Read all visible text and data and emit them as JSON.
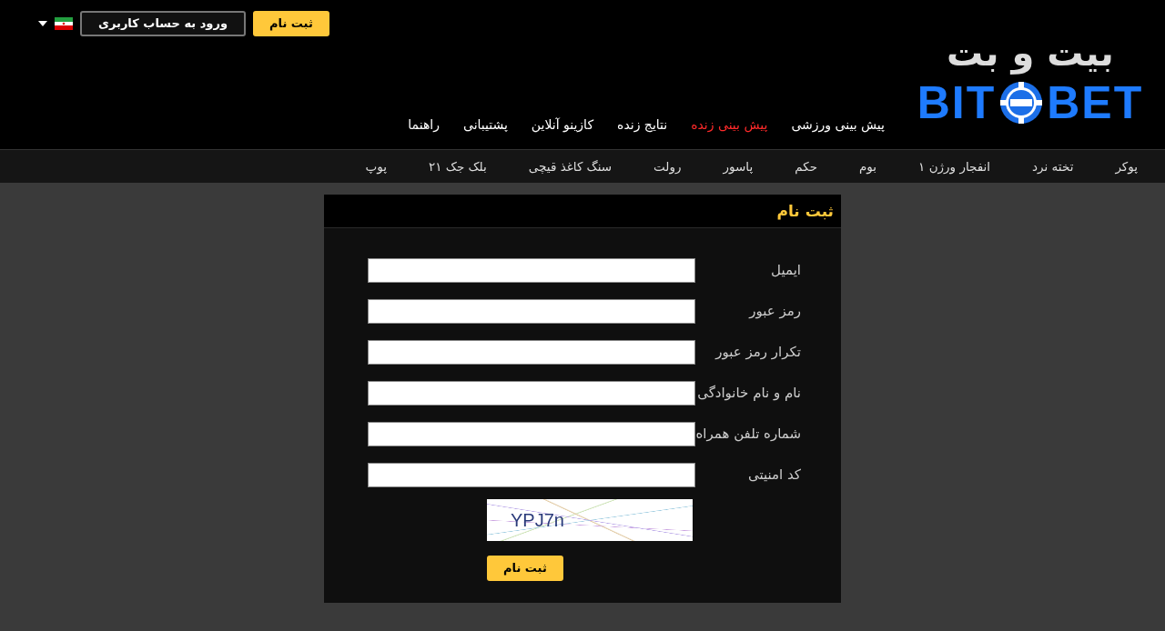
{
  "header": {
    "register_button": "ثبت نام",
    "login_button": "ورود به حساب کاربری"
  },
  "logo": {
    "persian": "بیت و بت",
    "left": "BIT",
    "right": "BET"
  },
  "main_nav": [
    {
      "label": "پیش بینی ورزشی",
      "selected": false
    },
    {
      "label": "پیش بینی زنده",
      "selected": true
    },
    {
      "label": "نتایج زنده",
      "selected": false
    },
    {
      "label": "کازینو آنلاین",
      "selected": false
    },
    {
      "label": "پشتیبانی",
      "selected": false
    },
    {
      "label": "راهنما",
      "selected": false
    }
  ],
  "games_nav": [
    "پوکر",
    "تخته نرد",
    "انفجار ورژن ۱",
    "بوم",
    "حکم",
    "پاسور",
    "رولت",
    "سنگ کاغذ قیچی",
    "بلک جک ۲۱",
    "پوپ"
  ],
  "form": {
    "title": "ثبت نام",
    "fields": [
      {
        "label": "ایمیل"
      },
      {
        "label": "رمز عبور"
      },
      {
        "label": "تکرار رمز عبور"
      },
      {
        "label": "نام و نام خانوادگی"
      },
      {
        "label": "شماره تلفن همراه"
      },
      {
        "label": "کد امنیتی"
      }
    ],
    "captcha": "YPJ7n",
    "submit": "ثبت نام"
  }
}
